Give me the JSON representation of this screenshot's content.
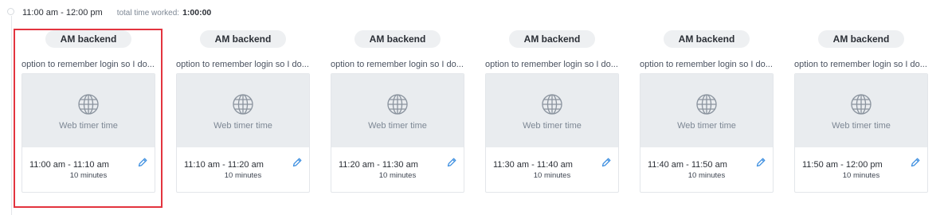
{
  "header": {
    "time_range": "11:00 am - 12:00 pm",
    "total_label": "total time worked:",
    "total_value": "1:00:00"
  },
  "cards": [
    {
      "project": "AM backend",
      "description": "option to remember login so I do...",
      "thumb_label": "Web timer time",
      "time_range": "11:00 am - 11:10 am",
      "duration": "10 minutes"
    },
    {
      "project": "AM backend",
      "description": "option to remember login so I do...",
      "thumb_label": "Web timer time",
      "time_range": "11:10 am - 11:20 am",
      "duration": "10 minutes"
    },
    {
      "project": "AM backend",
      "description": "option to remember login so I do...",
      "thumb_label": "Web timer time",
      "time_range": "11:20 am - 11:30 am",
      "duration": "10 minutes"
    },
    {
      "project": "AM backend",
      "description": "option to remember login so I do...",
      "thumb_label": "Web timer time",
      "time_range": "11:30 am - 11:40 am",
      "duration": "10 minutes"
    },
    {
      "project": "AM backend",
      "description": "option to remember login so I do...",
      "thumb_label": "Web timer time",
      "time_range": "11:40 am - 11:50 am",
      "duration": "10 minutes"
    },
    {
      "project": "AM backend",
      "description": "option to remember login so I do...",
      "thumb_label": "Web timer time",
      "time_range": "11:50 am - 12:00 pm",
      "duration": "10 minutes"
    }
  ],
  "icons": {
    "thumbnail": "globe-icon",
    "edit": "pencil-icon"
  },
  "colors": {
    "accent": "#3d8fe0",
    "selection": "#e3343f",
    "thumb_bg": "#e9ecef"
  }
}
